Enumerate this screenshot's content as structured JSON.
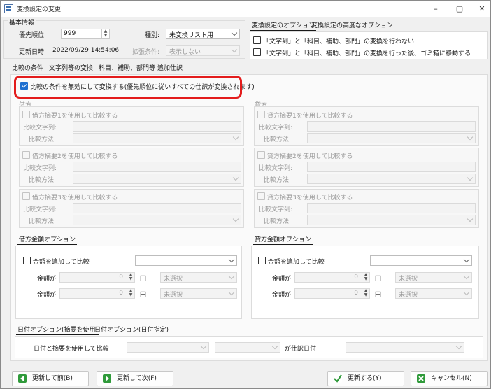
{
  "window": {
    "title": "変換設定の変更",
    "minimize": "–",
    "maximize": "▢",
    "close": "✕"
  },
  "basic": {
    "group_label": "基本情報",
    "priority_label": "優先順位:",
    "priority_value": "999",
    "type_label": "種別:",
    "type_value": "未変換リスト用",
    "updated_label": "更新日時:",
    "updated_value": "2022/09/29 14:54:06",
    "ext_label": "拡張条件:",
    "ext_value": "表示しない"
  },
  "options": {
    "tabs": [
      "変換設定のオプション",
      "変換設定の高度なオプション"
    ],
    "opt1": "「文字列」と「科目、補助、部門」の変換を行わない",
    "opt2": "「文字列」と「科目、補助、部門」の変換を行った後、ゴミ箱に移動する"
  },
  "main_tabs": [
    "比較の条件",
    "文字列等の変換",
    "科目、補助、部門等",
    "追加仕訳"
  ],
  "disable_compare": "比較の条件を無効にして変換する(優先順位に従いすべての仕訳が変換されます)",
  "debit": {
    "label": "借方",
    "g1": {
      "check": "借方摘要1を使用して比較する",
      "str": "比較文字列:",
      "method": "比較方法:"
    },
    "g2": {
      "check": "借方摘要2を使用して比較する",
      "str": "比較文字列:",
      "method": "比較方法:"
    },
    "g3": {
      "check": "借方摘要3を使用して比較する",
      "str": "比較文字列:",
      "method": "比較方法:"
    }
  },
  "credit": {
    "label": "貸方",
    "g1": {
      "check": "貸方摘要1を使用して比較する",
      "str": "比較文字列:",
      "method": "比較方法:"
    },
    "g2": {
      "check": "貸方摘要2を使用して比較する",
      "str": "比較文字列:",
      "method": "比較方法:"
    },
    "g3": {
      "check": "貸方摘要3を使用して比較する",
      "str": "比較文字列:",
      "method": "比較方法:"
    }
  },
  "debit_amount": {
    "tab": "借方金額オプション",
    "check": "金額を追加して比較",
    "row1_label": "金額が",
    "row1_value": "0",
    "unit": "円",
    "row1_select": "未選択",
    "row2_label": "金額が",
    "row2_value": "0",
    "row2_select": "未選択"
  },
  "credit_amount": {
    "tab": "貸方金額オプション",
    "check": "金額を追加して比較",
    "row1_label": "金額が",
    "row1_value": "0",
    "unit": "円",
    "row1_select": "未選択",
    "row2_label": "金額が",
    "row2_value": "0",
    "row2_select": "未選択"
  },
  "date": {
    "tabs": [
      "日付オプション(摘要を使用)",
      "日付オプション(日付指定)"
    ],
    "check": "日付と摘要を使用して比較",
    "mid_label": "が仕訳日付"
  },
  "buttons": {
    "prev": "更新して前(B)",
    "next": "更新して次(F)",
    "update": "更新する(Y)",
    "cancel": "キャンセル(N)"
  }
}
